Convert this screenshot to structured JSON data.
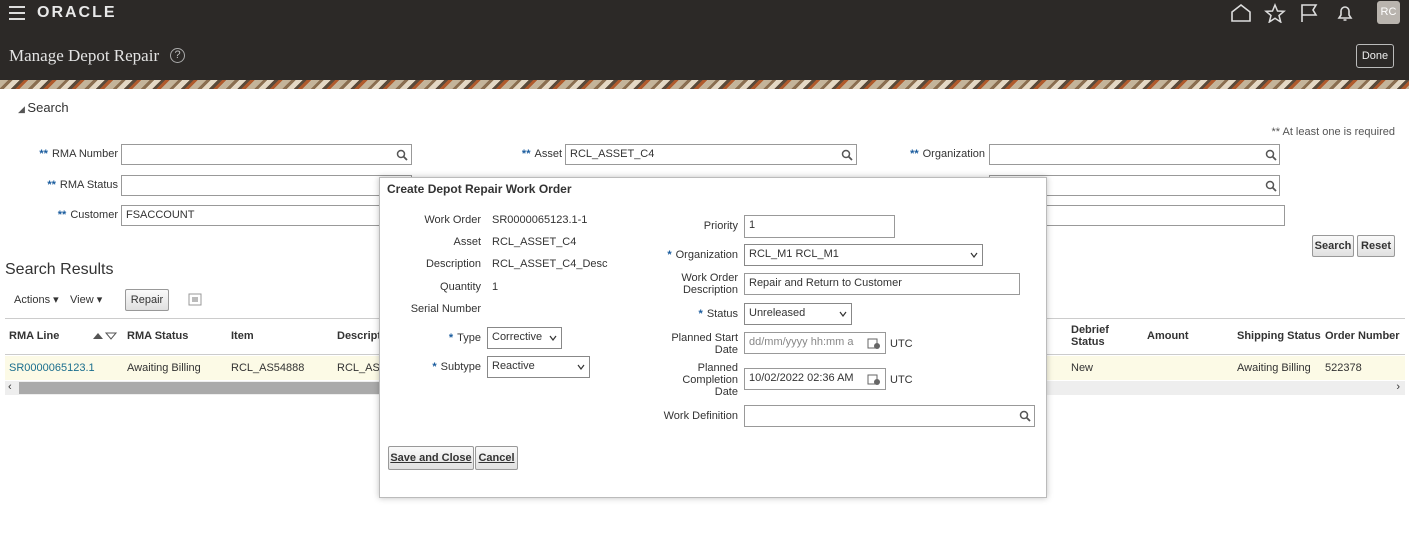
{
  "header": {
    "logo": "ORACLE",
    "avatar": "RC",
    "page_title": "Manage Depot Repair",
    "help": "?",
    "done": "Done"
  },
  "search": {
    "title": "Search",
    "required_note": "** At least one is required",
    "rma_number_label": "RMA Number",
    "rma_number_value": "",
    "asset_label": "Asset",
    "asset_value": "RCL_ASSET_C4",
    "organization_label": "Organization",
    "organization_value": "",
    "rma_status_label": "RMA Status",
    "rma_status_value": "",
    "customer_label": "Customer",
    "customer_value": "FSACCOUNT",
    "required_marker": "**",
    "search_btn": "Search",
    "reset_btn": "Reset"
  },
  "results": {
    "title": "Search Results",
    "actions": "Actions",
    "view": "View",
    "repair": "Repair",
    "columns": [
      "RMA Line",
      "RMA Status",
      "Item",
      "Descript",
      "Debrief Status",
      "Amount",
      "Shipping Status",
      "Order Number"
    ],
    "row": {
      "rma_line": "SR0000065123.1",
      "rma_status": "Awaiting Billing",
      "item": "RCL_AS54888",
      "desc": "RCL_AS",
      "debrief": "New",
      "shipping": "Awaiting Billing",
      "order": "522378"
    }
  },
  "dialog": {
    "title": "Create Depot Repair Work Order",
    "work_order_label": "Work Order",
    "work_order": "SR0000065123.1-1",
    "asset_label": "Asset",
    "asset": "RCL_ASSET_C4",
    "description_label": "Description",
    "description": "RCL_ASSET_C4_Desc",
    "quantity_label": "Quantity",
    "quantity": "1",
    "serial_label": "Serial Number",
    "type_label": "Type",
    "type": "Corrective",
    "subtype_label": "Subtype",
    "subtype": "Reactive",
    "priority_label": "Priority",
    "priority": "1",
    "organization_label": "Organization",
    "organization": "RCL_M1 RCL_M1",
    "wo_desc_label_1": "Work Order",
    "wo_desc_label_2": "Description",
    "wo_desc": "Repair and Return to Customer",
    "status_label": "Status",
    "status": "Unreleased",
    "start_label_1": "Planned Start",
    "start_label_2": "Date",
    "start_placeholder": "dd/mm/yyyy hh:mm a",
    "start_tz": "UTC",
    "completion_label_1": "Planned",
    "completion_label_2": "Completion",
    "completion_label_3": "Date",
    "completion": "10/02/2022 02:36 AM",
    "completion_tz": "UTC",
    "work_def_label": "Work Definition",
    "work_def": "",
    "save_close": "Save and Close",
    "cancel": "Cancel",
    "required_marker": "*"
  }
}
